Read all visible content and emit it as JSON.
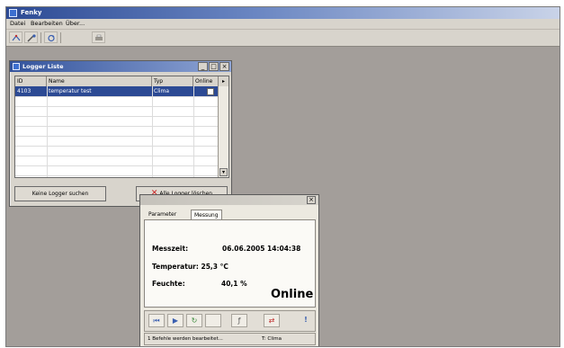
{
  "app": {
    "title": "Fenky"
  },
  "menu": {
    "items": [
      "Datei",
      "Bearbeiten",
      "Über..."
    ]
  },
  "toolbar": {
    "icons": [
      "connect-icon",
      "tools-icon",
      "refresh-icon",
      "print-icon"
    ]
  },
  "logger_window": {
    "title": "Logger Liste",
    "columns": [
      "ID",
      "Name",
      "Typ",
      "Online"
    ],
    "rows": [
      {
        "id": "4103",
        "name": "temperatur test",
        "typ": "Clima",
        "online": false
      }
    ],
    "search_button": "Keine Logger suchen",
    "delete_button": "Alle Logger löschen"
  },
  "messung_window": {
    "tabs": [
      "Parameter",
      "Messung"
    ],
    "active_tab": "Messung",
    "messzeit_label": "Messzeit:",
    "messzeit_value": "06.06.2005 14:04:38",
    "temperatur_label": "Temperatur: 25,3 °C",
    "feuchte_label": "Feuchte:",
    "feuchte_value": "40,1 %",
    "status_word": "Online",
    "statusbar_left": "1 Befehle werden bearbeitet...",
    "statusbar_right": "T: Clima"
  },
  "colors": {
    "accent_blue": "#2c4a94",
    "desktop": "#a39e9a",
    "delete_red": "#c81e1e"
  }
}
